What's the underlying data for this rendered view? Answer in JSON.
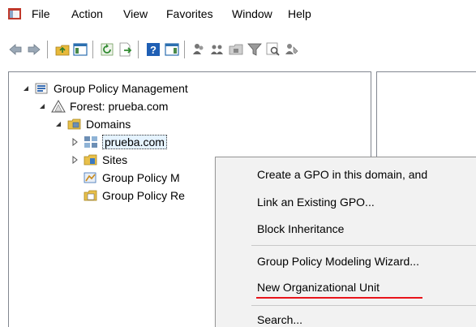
{
  "menubar": {
    "icon": "mmc-console-icon",
    "items": [
      "File",
      "Action",
      "View",
      "Favorites",
      "Window",
      "Help"
    ]
  },
  "toolbar": {
    "buttons": [
      "back-icon",
      "forward-icon",
      "up-folder-icon",
      "show-hide-tree-icon",
      "refresh-icon",
      "export-list-icon",
      "help-icon",
      "show-hide-action-pane-icon",
      "users-icon",
      "groups-icon",
      "org-unit-icon",
      "filter-icon",
      "find-icon",
      "delegate-icon"
    ]
  },
  "tree": {
    "root": "Group Policy Management",
    "forest": "Forest: prueba.com",
    "domains": "Domains",
    "domain": "prueba.com",
    "sites": "Sites",
    "modeling": "Group Policy M",
    "results": "Group Policy Re"
  },
  "context_menu": {
    "items": [
      "Create a GPO in this domain, and",
      "Link an Existing GPO...",
      "Block Inheritance",
      "Group Policy Modeling Wizard...",
      "New Organizational Unit",
      "Search..."
    ]
  },
  "colors": {
    "highlight_underline": "#e8141b",
    "menu_background": "#f2f2f2",
    "selection_fill": "#e5f3ff"
  }
}
